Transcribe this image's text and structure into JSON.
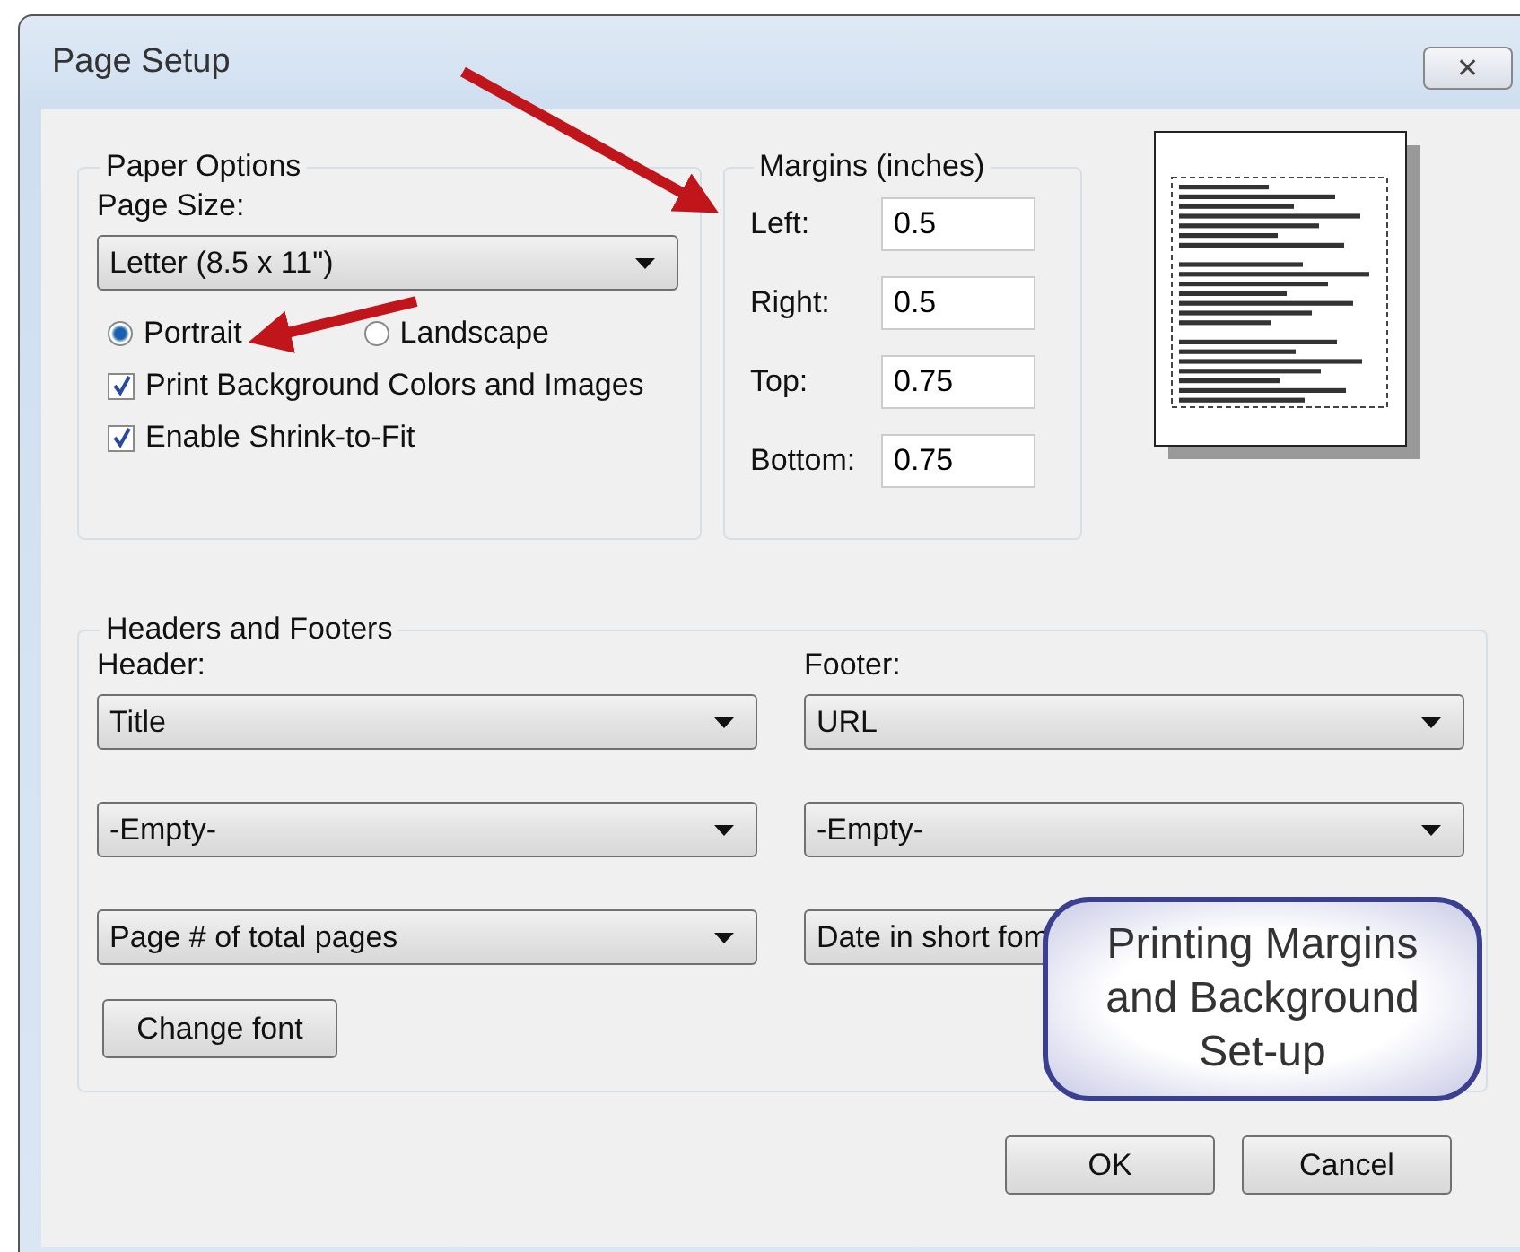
{
  "window": {
    "title": "Page Setup",
    "close": "✕"
  },
  "paper_options": {
    "title": "Paper Options",
    "page_size_label": "Page Size:",
    "page_size": "Letter (8.5 x 11\")",
    "orientations": [
      {
        "label": "Portrait",
        "selected": true
      },
      {
        "label": "Landscape",
        "selected": false
      }
    ],
    "checkboxes": [
      {
        "label": "Print Background Colors and Images",
        "checked": true
      },
      {
        "label": "Enable Shrink-to-Fit",
        "checked": true
      }
    ]
  },
  "margins": {
    "title": "Margins (inches)",
    "fields": [
      {
        "label": "Left:",
        "value": "0.5"
      },
      {
        "label": "Right:",
        "value": "0.5"
      },
      {
        "label": "Top:",
        "value": "0.75"
      },
      {
        "label": "Bottom:",
        "value": "0.75"
      }
    ]
  },
  "headers_footers": {
    "title": "Headers and Footers",
    "header_label": "Header:",
    "footer_label": "Footer:",
    "header": [
      "Title",
      "-Empty-",
      "Page # of total pages"
    ],
    "footer": [
      "URL",
      "-Empty-",
      "Date in short fom"
    ],
    "change_font": "Change font"
  },
  "buttons": [
    "OK",
    "Cancel"
  ],
  "callout": "Printing Margins and Background Set-up"
}
